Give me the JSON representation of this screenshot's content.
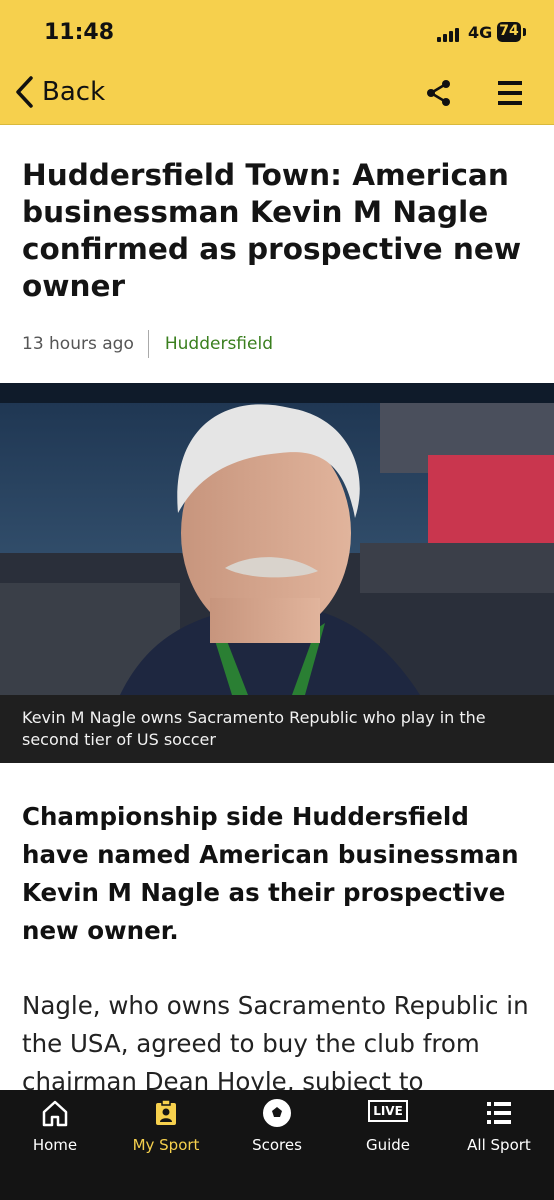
{
  "status_bar": {
    "time": "11:48",
    "network": "4G",
    "battery": "74"
  },
  "app_bar": {
    "back_label": "Back",
    "share_icon": "share-icon",
    "menu_icon": "hamburger-menu-icon"
  },
  "article": {
    "headline": "Huddersfield Town: American businessman Kevin M Nagle confirmed as prospective new owner",
    "timestamp": "13 hours ago",
    "topic": "Huddersfield",
    "image_caption": "Kevin M Nagle owns Sacramento Republic who play in the second tier of US soccer",
    "intro": "Championship side Huddersfield have named American businessman Kevin M Nagle as their prospective new owner.",
    "body": "Nagle, who owns Sacramento Republic in the USA, agreed to buy the club from chairman Dean Hoyle, subject to"
  },
  "colors": {
    "brand_yellow": "#f6d04d",
    "topic_green": "#3a7f1e",
    "tabbar_bg": "#141414"
  },
  "tab_bar": {
    "tabs": [
      {
        "label": "Home",
        "icon": "home-icon"
      },
      {
        "label": "My Sport",
        "icon": "my-sport-icon",
        "active": true
      },
      {
        "label": "Scores",
        "icon": "football-icon"
      },
      {
        "label": "Guide",
        "icon": "live-icon",
        "badge": "LIVE"
      },
      {
        "label": "All Sport",
        "icon": "list-icon"
      }
    ]
  }
}
